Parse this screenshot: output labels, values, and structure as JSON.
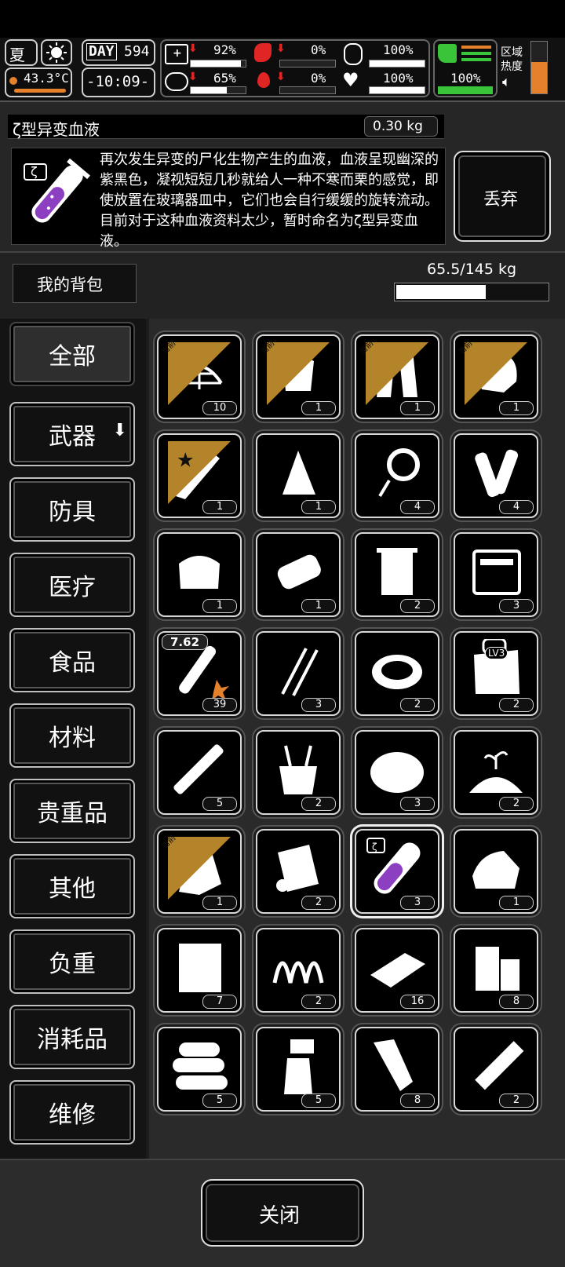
{
  "status": {
    "season": "夏",
    "temperature": "43.3°C",
    "day_label": "DAY",
    "day_value": "594",
    "clock": "-10:09-",
    "health_pct": "92%",
    "hunger_pct": "0%",
    "stamina_pct": "65%",
    "thirst_pct": "0%",
    "shield_pct": "100%",
    "mood_pct": "100%",
    "boots_pct": "100%",
    "region_label_1": "区域",
    "region_label_2": "热度"
  },
  "item_detail": {
    "name": "ζ型异变血液",
    "weight": "0.30 kg",
    "description": "再次发生异变的尸化生物产生的血液，血液呈现幽深的紫黑色，凝视短短几秒就给人一种不寒而栗的感觉，即使放置在玻璃器皿中，它们也会自行缓缓的旋转流动。目前对于这种血液资料太少，暂时命名为ζ型异变血液。",
    "vial_badge": "ζ",
    "discard_label": "丢弃"
  },
  "backpack": {
    "title": "我的背包",
    "weight": "65.5/145 kg",
    "fill": 0.6
  },
  "categories": [
    "全部",
    "武器",
    "防具",
    "医疗",
    "食品",
    "材料",
    "贵重品",
    "其他",
    "负重",
    "消耗品",
    "维修"
  ],
  "grid": {
    "equipped_tag": "当前",
    "ammo_caliber": "7.62",
    "map_level": "LV3",
    "counts": [
      "10",
      "1",
      "1",
      "1",
      "1",
      "1",
      "4",
      "4",
      "1",
      "1",
      "2",
      "3",
      "39",
      "3",
      "2",
      "2",
      "5",
      "2",
      "3",
      "2",
      "1",
      "2",
      "3",
      "1",
      "7",
      "2",
      "16",
      "8",
      "5",
      "5",
      "8",
      "2"
    ]
  },
  "close_label": "关闭",
  "colors": {
    "accent_green": "#39c43a",
    "alert_red": "#e02525",
    "vial_purple": "#8d3fc2",
    "heat_orange": "#e5812b"
  }
}
